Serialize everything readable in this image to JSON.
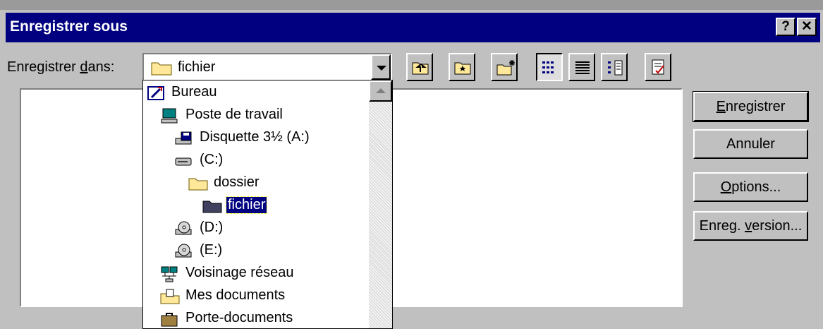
{
  "window": {
    "title": "Enregistrer sous",
    "help_label": "?",
    "close_label": "✕"
  },
  "save_in": {
    "label_pre": "Enregistrer ",
    "label_ul": "d",
    "label_post": "ans:",
    "value": "fichier"
  },
  "toolbar": [
    {
      "name": "up-one-level-button",
      "icon": "folder-up-icon"
    },
    {
      "name": "favorites-button",
      "icon": "favorites-folder-icon"
    },
    {
      "name": "new-folder-button",
      "icon": "new-folder-icon"
    },
    {
      "name": "list-view-button",
      "icon": "list-icon",
      "pressed": true
    },
    {
      "name": "details-view-button",
      "icon": "details-icon"
    },
    {
      "name": "properties-view-button",
      "icon": "properties-icon"
    },
    {
      "name": "tools-button",
      "icon": "tools-icon"
    }
  ],
  "locations": [
    {
      "label": "Bureau",
      "icon": "desktop-icon"
    },
    {
      "label": "Poste de travail",
      "icon": "computer-icon"
    },
    {
      "label": "Disquette 3½ (A:)",
      "icon": "floppy-drive-icon"
    },
    {
      "label": "(C:)",
      "icon": "hard-drive-icon"
    },
    {
      "label": "dossier",
      "icon": "folder-icon"
    },
    {
      "label": "fichier",
      "icon": "open-folder-icon",
      "selected": true
    },
    {
      "label": "(D:)",
      "icon": "cd-drive-icon"
    },
    {
      "label": "(E:)",
      "icon": "cd-drive-icon"
    },
    {
      "label": "Voisinage réseau",
      "icon": "network-icon"
    },
    {
      "label": "Mes documents",
      "icon": "my-documents-icon"
    },
    {
      "label": "Porte-documents",
      "icon": "briefcase-icon"
    }
  ],
  "buttons": {
    "save": {
      "ul": "E",
      "rest": "nregistrer"
    },
    "cancel": {
      "label": "Annuler"
    },
    "options": {
      "ul": "O",
      "rest": "ptions..."
    },
    "save_version": {
      "pre": "Enreg. ",
      "ul": "v",
      "rest": "ersion..."
    }
  }
}
